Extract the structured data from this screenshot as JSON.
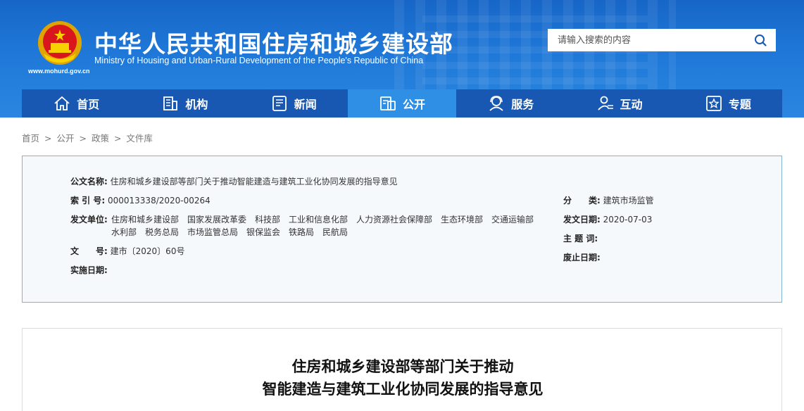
{
  "header": {
    "title": "中华人民共和国住房和城乡建设部",
    "subtitle": "Ministry of Housing and Urban-Rural Development of the People's Republic of China",
    "url": "www.mohurd.gov.cn",
    "search_placeholder": "请输入搜索的内容"
  },
  "nav": [
    {
      "label": "首页",
      "icon": "home-icon"
    },
    {
      "label": "机构",
      "icon": "building-icon"
    },
    {
      "label": "新闻",
      "icon": "news-icon"
    },
    {
      "label": "公开",
      "icon": "document-icon",
      "active": true
    },
    {
      "label": "服务",
      "icon": "service-icon"
    },
    {
      "label": "互动",
      "icon": "interaction-icon"
    },
    {
      "label": "专题",
      "icon": "star-icon"
    }
  ],
  "breadcrumb": [
    "首页",
    "公开",
    "政策",
    "文件库"
  ],
  "breadcrumb_sep": ">",
  "meta": {
    "doc_name_label": "公文名称:",
    "doc_name": "住房和城乡建设部等部门关于推动智能建造与建筑工业化协同发展的指导意见",
    "index_label": "索 引 号:",
    "index": "000013338/2020-00264",
    "issuer_label": "发文单位:",
    "issuer": "住房和城乡建设部　国家发展改革委　科技部　工业和信息化部　人力资源社会保障部　生态环境部　交通运输部　水利部　税务总局　市场监管总局　银保监会　铁路局　民航局",
    "doc_no_label": "文　　号:",
    "doc_no": "建市〔2020〕60号",
    "effective_label": "实施日期:",
    "effective": "",
    "category_label": "分　　类:",
    "category": "建筑市场监管",
    "date_label": "发文日期:",
    "date": "2020-07-03",
    "subject_label": "主 题 词:",
    "subject": "",
    "abolish_label": "废止日期:",
    "abolish": ""
  },
  "article": {
    "title_line1": "住房和城乡建设部等部门关于推动",
    "title_line2": "智能建造与建筑工业化协同发展的指导意见"
  },
  "colors": {
    "header_blue": "#1f78d8",
    "nav_blue": "#1857b2",
    "nav_active": "#2f8fe5",
    "meta_border": "#7fb3cf"
  }
}
